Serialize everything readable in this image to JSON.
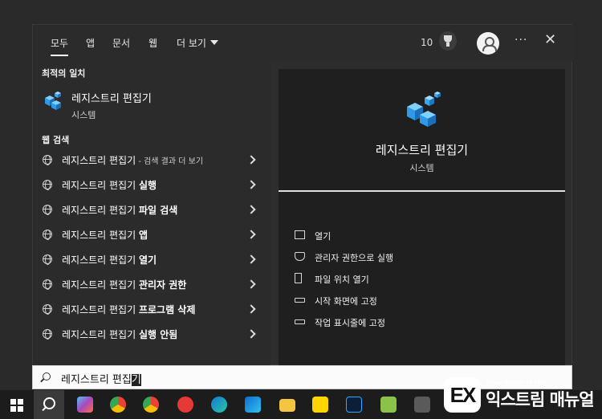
{
  "tabs": [
    "모두",
    "앱",
    "문서",
    "웹",
    "더 보기"
  ],
  "header": {
    "points": "10"
  },
  "best_match": {
    "section": "최적의 일치",
    "name": "레지스트리 편집기",
    "type": "시스템"
  },
  "web": {
    "section": "웹 검색",
    "items": [
      {
        "base": "레지스트리 편집기",
        "bold": "",
        "suffix": " - 검색 결과 더 보기"
      },
      {
        "base": "레지스트리 편집기 ",
        "bold": "실행",
        "suffix": ""
      },
      {
        "base": "레지스트리 편집기 ",
        "bold": "파일 검색",
        "suffix": ""
      },
      {
        "base": "레지스트리 편집기 ",
        "bold": "앱",
        "suffix": ""
      },
      {
        "base": "레지스트리 편집기 ",
        "bold": "열기",
        "suffix": ""
      },
      {
        "base": "레지스트리 편집기 ",
        "bold": "관리자 권한",
        "suffix": ""
      },
      {
        "base": "레지스트리 편집기 ",
        "bold": "프로그램 삭제",
        "suffix": ""
      },
      {
        "base": "레지스트리 편집기 ",
        "bold": "실행 안됨",
        "suffix": ""
      }
    ]
  },
  "preview": {
    "name": "레지스트리 편집기",
    "type": "시스템",
    "actions": [
      "열기",
      "관리자 권한으로 실행",
      "파일 위치 열기",
      "시작 화면에 고정",
      "작업 표시줄에 고정"
    ]
  },
  "search": {
    "typed": "레지스트리 편집",
    "selected": "기"
  },
  "watermark": {
    "tagline": "More Better IT Life",
    "name": "익스트림 매뉴얼",
    "mark": "EX"
  },
  "colors": {
    "accent_blue": "#2f9be8",
    "taskbar": "#1c1c1c",
    "panel": "#2d2d2d"
  }
}
